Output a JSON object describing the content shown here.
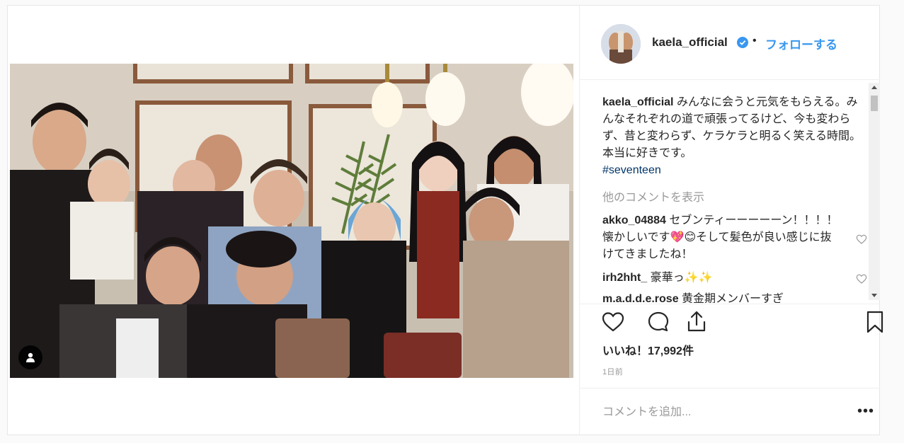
{
  "post": {
    "username": "kaela_official",
    "follow_label": "フォローする",
    "separator": "•",
    "caption_username": "kaela_official",
    "caption_text": "みんなに会うと元気をもらえる。みんなそれぞれの道で頑張ってるけど、今も変わらず、昔と変わらず、ケラケラと明るく笑える時間。本当に好きです。",
    "hashtag": "#seventeen",
    "view_more_comments": "他のコメントを表示",
    "comments": [
      {
        "user": "akko_04884",
        "text": "セブンティーーーーーン！！！！懐かしいです💖😊そして髪色が良い感じに抜けてきましたね！"
      },
      {
        "user": "irh2hht_",
        "text": "豪華っ✨✨"
      },
      {
        "user": "m.a.d.d.e.rose",
        "text": "黄金期メンバーすぎ"
      }
    ],
    "likes_label": "いいね！17,992件",
    "timestamp": "1日前",
    "comment_placeholder": "コメントを追加...",
    "more_options": "•••"
  },
  "icons": {
    "verified": "verified-badge-icon",
    "like": "heart-icon",
    "comment": "comment-icon",
    "share": "share-icon",
    "save": "bookmark-icon",
    "user_tag": "user-tag-icon"
  },
  "colors": {
    "link_blue": "#3897f0",
    "hashtag": "#003569",
    "muted": "#999999",
    "text": "#262626"
  }
}
